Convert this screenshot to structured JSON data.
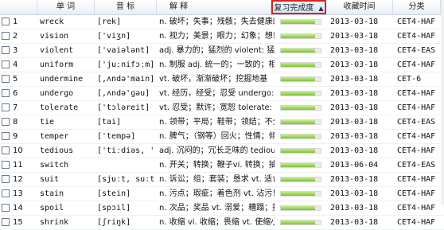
{
  "header": {
    "word": "单 词",
    "phonetic": "音 标",
    "meaning": "解 释",
    "progress": "复习完成度",
    "sort_arrow": "▲",
    "date": "收藏时间",
    "category": "分类"
  },
  "rows": [
    {
      "num": "1",
      "word": "wreck",
      "phonetic": "[rek]",
      "meaning": "n. 破坏；失事；残骸；失去健康的人",
      "progress": 0.85,
      "date": "2013-03-18",
      "category": "CET4-HAF"
    },
    {
      "num": "2",
      "word": "vision",
      "phonetic": "['viʒn]",
      "meaning": "n. 视力；美景；眼力；幻象；想象力",
      "progress": 0.85,
      "date": "2013-03-18",
      "category": "CET4-HAF"
    },
    {
      "num": "3",
      "word": "violent",
      "phonetic": "['vaiələnt]",
      "meaning": "adj. 暴力的；猛烈的 violent: 猛",
      "progress": 0.85,
      "date": "2013-03-18",
      "category": "CET4-EAS"
    },
    {
      "num": "4",
      "word": "uniform",
      "phonetic": "['juːnifɔːm]",
      "meaning": "n. 制服 adj. 统一的；一致的；相",
      "progress": 0.85,
      "date": "2013-03-18",
      "category": "CET4-HAF"
    },
    {
      "num": "5",
      "word": "undermine",
      "phonetic": "[,ʌndə'main]",
      "meaning": "vt. 破坏，渐渐破坏；挖掘地基",
      "progress": 0.85,
      "date": "2013-03-18",
      "category": "CET-6"
    },
    {
      "num": "6",
      "word": "undergo",
      "phonetic": "[,ʌndə'ɡəu]",
      "meaning": "vt. 经历，经受；忍受 undergo: 经",
      "progress": 0.85,
      "date": "2013-03-18",
      "category": "CET4-HAF"
    },
    {
      "num": "7",
      "word": "tolerate",
      "phonetic": "['tɔləreit]",
      "meaning": "vt. 忍受；默许；宽恕 tolerate: 默",
      "progress": 0.85,
      "date": "2013-03-18",
      "category": "CET4-HAF"
    },
    {
      "num": "8",
      "word": "tie",
      "phonetic": "[tai]",
      "meaning": "n. 领带；平局；鞋带；领结；不分胜",
      "progress": 0.85,
      "date": "2013-03-18",
      "category": "CET4-EAS"
    },
    {
      "num": "9",
      "word": "temper",
      "phonetic": "['tempə]",
      "meaning": "n. 脾气；（钢等）回火；性情；倾向",
      "progress": 0.85,
      "date": "2013-03-18",
      "category": "CET4-HAF"
    },
    {
      "num": "10",
      "word": "tedious",
      "phonetic": "['tiːdiəs, '",
      "meaning": "adj. 沉闷的；冗长乏味的 tedious:",
      "progress": 0.85,
      "date": "2013-03-18",
      "category": "CET4-HAF"
    },
    {
      "num": "11",
      "word": "switch",
      "phonetic": "",
      "meaning": "n. 开关；转换；鞭子vi. 转换；抽打",
      "progress": 0.85,
      "date": "2013-06-04",
      "category": "CET4-EAS"
    },
    {
      "num": "12",
      "word": "suit",
      "phonetic": "[sjuːt, suːt",
      "meaning": "n. 诉讼；组；套装；恳求 vt. 适合",
      "progress": 0.85,
      "date": "2013-03-18",
      "category": "CET4-HAF"
    },
    {
      "num": "13",
      "word": "stain",
      "phonetic": "[stein]",
      "meaning": "n. 污点；瑕疵；着色剂 vt. 沾污！！",
      "progress": 0.85,
      "date": "2013-03-18",
      "category": "CET4-HAF"
    },
    {
      "num": "14",
      "word": "spoil",
      "phonetic": "[spɔil]",
      "meaning": "n. 次品；奖品 vt. 溺爱；糟蹋；掠",
      "progress": 0.85,
      "date": "2013-03-18",
      "category": "CET4-HAF"
    },
    {
      "num": "15",
      "word": "shrink",
      "phonetic": "[ʃriŋk]",
      "meaning": "n. 收缩 vi. 收缩；畏缩 vt. 使缩小",
      "progress": 0.85,
      "date": "2013-03-18",
      "category": "CET4-HAF"
    }
  ]
}
